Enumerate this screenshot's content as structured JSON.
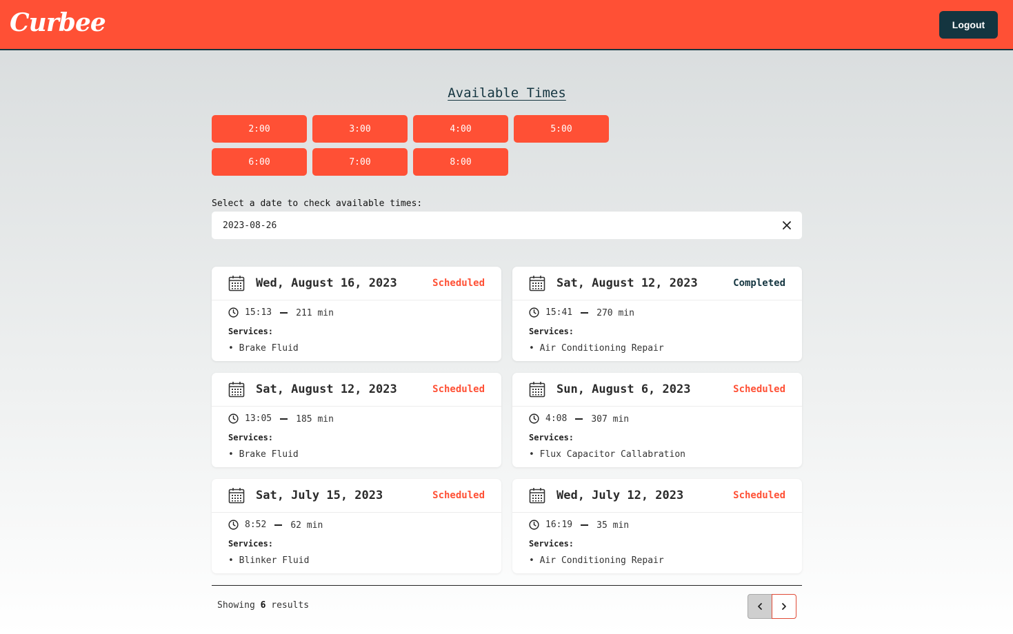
{
  "header": {
    "logo_text": "Curbee",
    "logout_label": "Logout"
  },
  "available_times": {
    "title": "Available Times",
    "slots": [
      "2:00",
      "3:00",
      "4:00",
      "5:00",
      "6:00",
      "7:00",
      "8:00"
    ]
  },
  "date_picker": {
    "label": "Select a date to check available times:",
    "value": "2023-08-26"
  },
  "labels": {
    "services": "Services:"
  },
  "appointments": [
    {
      "date": "Wed, August 16, 2023",
      "status": "Scheduled",
      "time": "15:13",
      "duration": "211 min",
      "service": "Brake Fluid"
    },
    {
      "date": "Sat, August 12, 2023",
      "status": "Completed",
      "time": "15:41",
      "duration": "270 min",
      "service": "Air Conditioning Repair"
    },
    {
      "date": "Sat, August 12, 2023",
      "status": "Scheduled",
      "time": "13:05",
      "duration": "185 min",
      "service": "Brake Fluid"
    },
    {
      "date": "Sun, August 6, 2023",
      "status": "Scheduled",
      "time": "4:08",
      "duration": "307 min",
      "service": "Flux Capacitor Callabration"
    },
    {
      "date": "Sat, July 15, 2023",
      "status": "Scheduled",
      "time": "8:52",
      "duration": "62 min",
      "service": "Blinker Fluid"
    },
    {
      "date": "Wed, July 12, 2023",
      "status": "Scheduled",
      "time": "16:19",
      "duration": "35 min",
      "service": "Air Conditioning Repair"
    }
  ],
  "footer": {
    "showing_prefix": "Showing",
    "count": "6",
    "showing_suffix": "results"
  },
  "colors": {
    "brand": "#ff5035",
    "dark": "#143540"
  }
}
